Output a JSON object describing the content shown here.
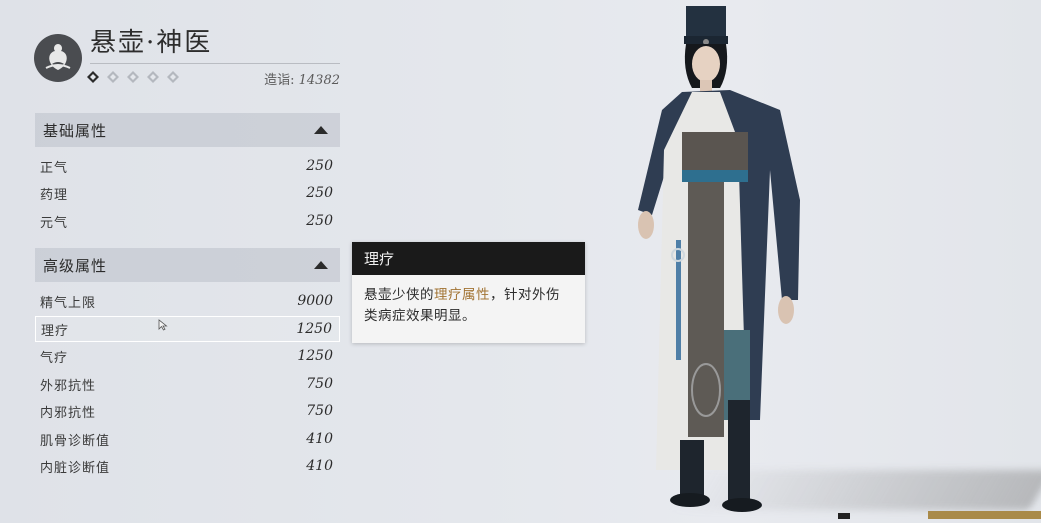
{
  "header": {
    "title": "悬壶·神医",
    "score_label": "造诣:",
    "score_value": "14382",
    "pips": [
      "filled-diamond-icon",
      "diamond-icon",
      "diamond-icon",
      "diamond-icon",
      "diamond-icon"
    ]
  },
  "basic": {
    "title": "基础属性",
    "rows": [
      {
        "name": "正气",
        "value": "250"
      },
      {
        "name": "药理",
        "value": "250"
      },
      {
        "name": "元气",
        "value": "250"
      }
    ]
  },
  "advanced": {
    "title": "高级属性",
    "rows": [
      {
        "name": "精气上限",
        "value": "9000"
      },
      {
        "name": "理疗",
        "value": "1250"
      },
      {
        "name": "气疗",
        "value": "1250"
      },
      {
        "name": "外邪抗性",
        "value": "750"
      },
      {
        "name": "内邪抗性",
        "value": "750"
      },
      {
        "name": "肌骨诊断值",
        "value": "410"
      },
      {
        "name": "内脏诊断值",
        "value": "410"
      }
    ]
  },
  "tooltip": {
    "title": "理疗",
    "text_before": "悬壶少侠的",
    "highlight": "理疗属性",
    "text_after": "，针对外伤类病症效果明显。"
  },
  "colors": {
    "highlight": "#a27434",
    "tooltip_header": "#1a1a1a",
    "panel_bg": "#e4e7ec"
  }
}
